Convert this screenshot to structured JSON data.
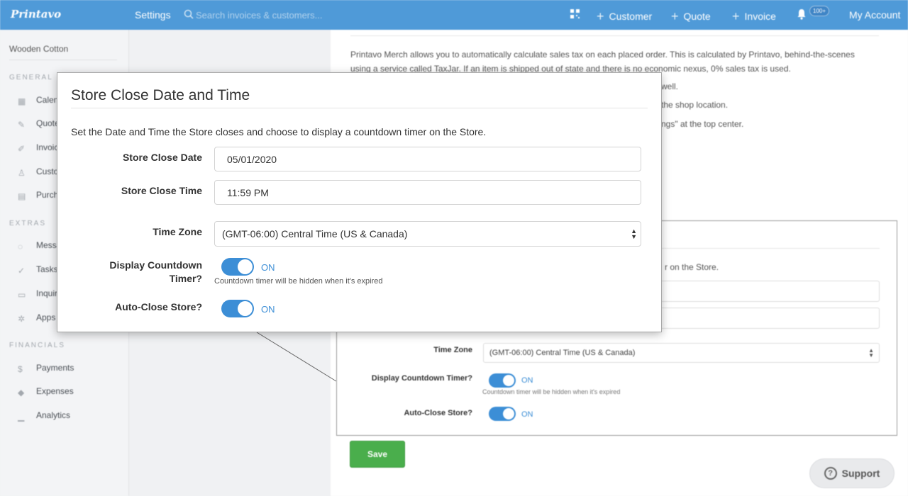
{
  "topbar": {
    "brand": "Printavo",
    "settings": "Settings",
    "search_placeholder": "Search invoices & customers...",
    "customer": "Customer",
    "quote": "Quote",
    "invoice": "Invoice",
    "badge": "100+",
    "account": "My Account"
  },
  "sidebar": {
    "shop_name": "Wooden Cotton",
    "general_label": "GENERAL",
    "extras_label": "EXTRAS",
    "financials_label": "FINANCIALS",
    "general": [
      "Calendar",
      "Quotes",
      "Invoices",
      "Customers",
      "Purchase Orders"
    ],
    "extras": [
      "Messages",
      "Tasks",
      "Inquiries",
      "Apps"
    ],
    "financials": [
      "Payments",
      "Expenses",
      "Analytics"
    ]
  },
  "background": {
    "tax_text": "Printavo Merch allows you to automatically calculate sales tax on each placed order. This is calculated by Printavo, behind-the-scenes using a service called TaxJar. If an item is shipped out of state and there is no economic nexus, 0% sales tax is used.",
    "tail_1": "well.",
    "tail_2": "the shop location.",
    "tail_3": "ngs\" at the top center.",
    "panel_tail": "r on the Store.",
    "time_zone_label": "Time Zone",
    "time_zone_value": "(GMT-06:00) Central Time (US & Canada)",
    "countdown_label": "Display Countdown Timer?",
    "countdown_state": "ON",
    "countdown_hint": "Countdown timer will be hidden when it's expired",
    "autoclose_label": "Auto-Close Store?",
    "autoclose_state": "ON",
    "save": "Save",
    "support": "Support"
  },
  "modal": {
    "title": "Store Close Date and Time",
    "description": "Set the Date and Time the Store closes and choose to display a countdown timer on the Store.",
    "close_date_label": "Store Close Date",
    "close_date_value": "05/01/2020",
    "close_time_label": "Store Close Time",
    "close_time_value": "11:59 PM",
    "time_zone_label": "Time Zone",
    "time_zone_value": "(GMT-06:00) Central Time (US & Canada)",
    "countdown_label_1": "Display Countdown",
    "countdown_label_2": "Timer?",
    "countdown_state": "ON",
    "countdown_hint": "Countdown timer will be hidden when it's expired",
    "autoclose_label": "Auto-Close Store?",
    "autoclose_state": "ON"
  },
  "colors": {
    "topbar": "#4f9ad8",
    "toggle_on": "#3c8ed6",
    "save": "#4aae4c"
  }
}
